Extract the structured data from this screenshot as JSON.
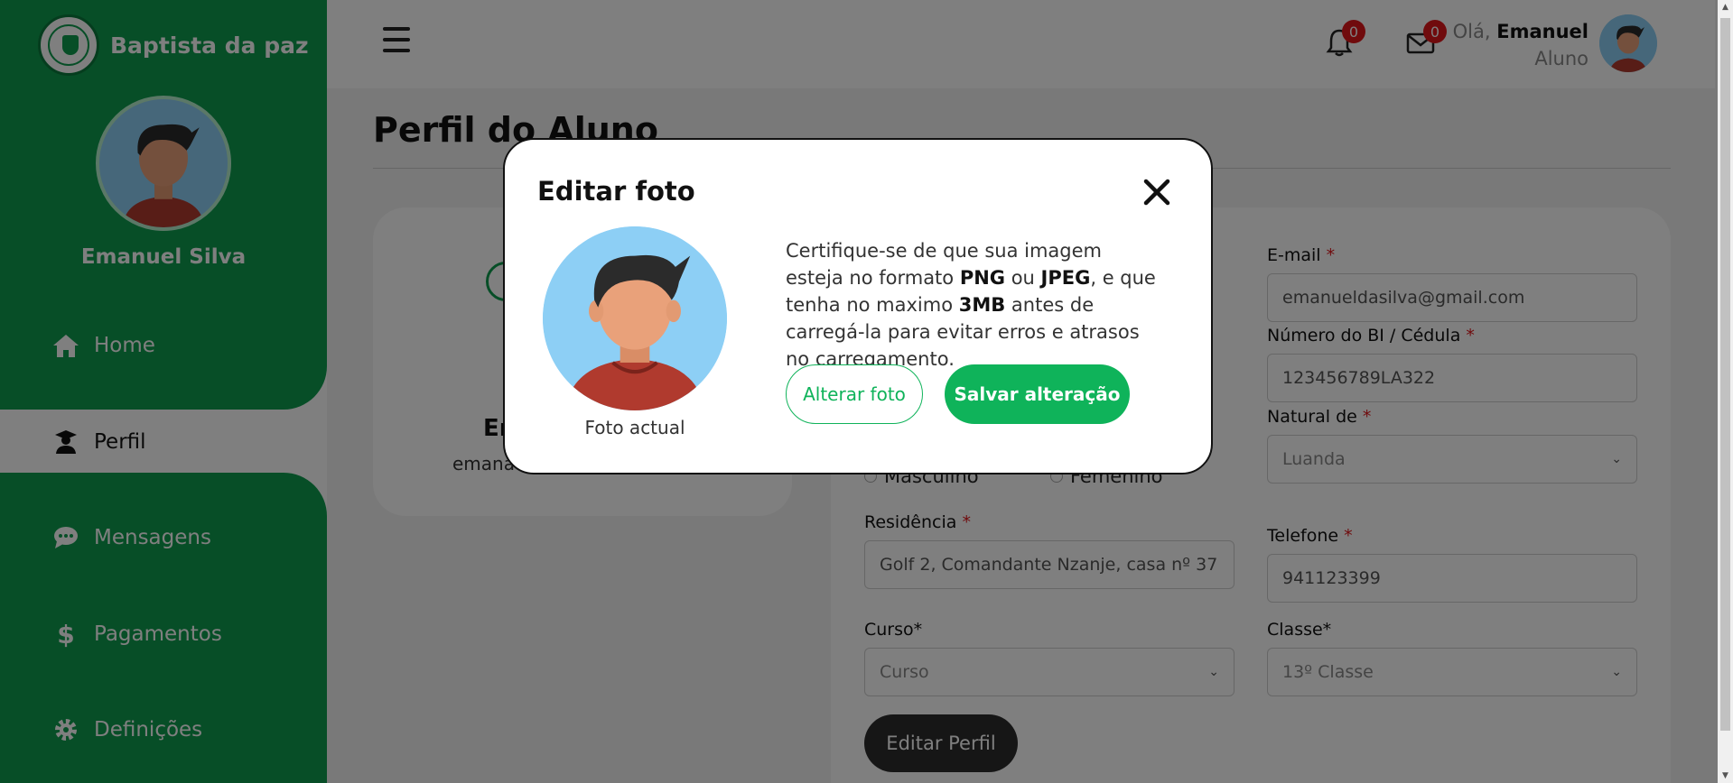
{
  "brand": {
    "name": "Baptista da paz"
  },
  "sidebar": {
    "user_name": "Emanuel Silva",
    "items": [
      {
        "label": "Home",
        "icon": "home-icon"
      },
      {
        "label": "Perfil",
        "icon": "graduate-icon"
      },
      {
        "label": "Mensagens",
        "icon": "chat-icon"
      },
      {
        "label": "Pagamentos",
        "icon": "dollar-icon"
      },
      {
        "label": "Definições",
        "icon": "gear-icon"
      }
    ]
  },
  "header": {
    "notifications_count": "0",
    "messages_count": "0",
    "greeting": "Olá,",
    "user_first_name": "Emanuel",
    "role": "Aluno"
  },
  "page": {
    "title": "Perfil do Aluno",
    "card_name": "Em",
    "card_email": "emana"
  },
  "form": {
    "email_label": "E-mail",
    "email_value": "emanueldasilva@gmail.com",
    "bi_label": "Número do BI / Cédula",
    "bi_value": "123456789LA322",
    "natural_label": "Natural de",
    "natural_value": "Luanda",
    "gender_masc": "Masculino",
    "gender_fem": "Femenino",
    "residence_label": "Residência",
    "residence_value": "Golf 2, Comandante Nzanje, casa nº 37",
    "phone_label": "Telefone",
    "phone_value": "941123399",
    "curso_label": "Curso*",
    "curso_value": "Curso",
    "classe_label": "Classe*",
    "classe_value": "13º Classe",
    "required_mark": "*",
    "edit_button": "Editar Perfil"
  },
  "modal": {
    "title": "Editar foto",
    "caption": "Foto actual",
    "text_1": "Certifique-se de que sua imagem esteja no formato ",
    "png": "PNG",
    "text_2": " ou ",
    "jpeg": "JPEG",
    "text_3": ", e que tenha no maximo ",
    "size": "3MB",
    "text_4": " antes de carregá-la para evitar erros e atrasos no carregamento.",
    "change_button": "Alterar foto",
    "save_button": "Salvar alteração"
  },
  "colors": {
    "brand_green": "#0f9d4f",
    "button_green": "#0fb35a",
    "badge_red": "#e0171b"
  }
}
